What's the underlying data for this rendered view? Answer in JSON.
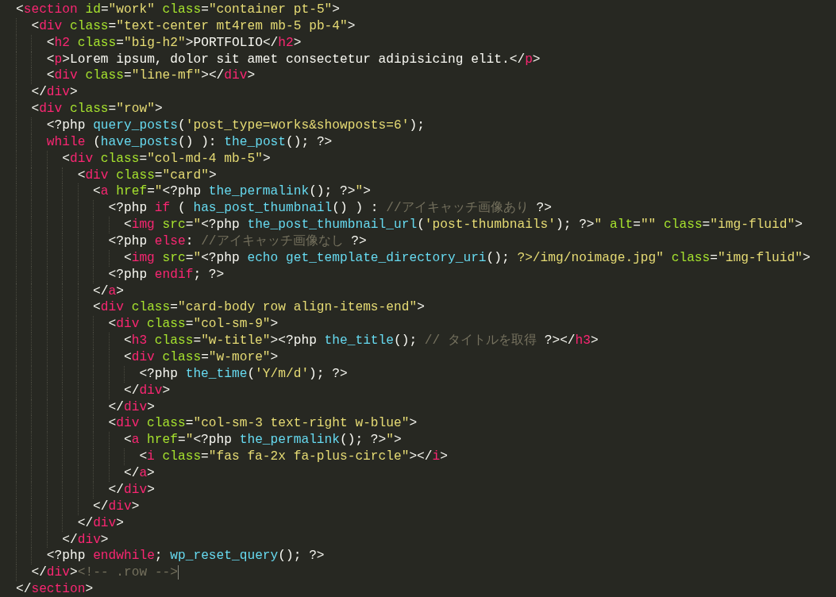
{
  "editor": {
    "lines": [
      {
        "cursor": false,
        "tokens": [
          {
            "kind": "punct",
            "text": "<"
          },
          {
            "kind": "tag",
            "text": "section"
          },
          {
            "kind": "attr",
            "text": " id"
          },
          {
            "kind": "punct",
            "text": "="
          },
          {
            "kind": "string",
            "text": "\"work\""
          },
          {
            "kind": "attr",
            "text": " class"
          },
          {
            "kind": "punct",
            "text": "="
          },
          {
            "kind": "string",
            "text": "\"container pt-5\""
          },
          {
            "kind": "punct",
            "text": ">"
          }
        ]
      },
      {
        "cursor": false,
        "tokens": [
          {
            "kind": "punct",
            "text": "  <"
          },
          {
            "kind": "tag",
            "text": "div"
          },
          {
            "kind": "attr",
            "text": " class"
          },
          {
            "kind": "punct",
            "text": "="
          },
          {
            "kind": "string",
            "text": "\"text-center mt4rem mb-5 pb-4\""
          },
          {
            "kind": "punct",
            "text": ">"
          }
        ]
      },
      {
        "cursor": false,
        "tokens": [
          {
            "kind": "punct",
            "text": "    <"
          },
          {
            "kind": "tag",
            "text": "h2"
          },
          {
            "kind": "attr",
            "text": " class"
          },
          {
            "kind": "punct",
            "text": "="
          },
          {
            "kind": "string",
            "text": "\"big-h2\""
          },
          {
            "kind": "punct",
            "text": ">PORTFOLIO</"
          },
          {
            "kind": "tag",
            "text": "h2"
          },
          {
            "kind": "punct",
            "text": ">"
          }
        ]
      },
      {
        "cursor": false,
        "tokens": [
          {
            "kind": "punct",
            "text": "    <"
          },
          {
            "kind": "tag",
            "text": "p"
          },
          {
            "kind": "punct",
            "text": ">Lorem ipsum, dolor sit amet consectetur adipisicing elit.</"
          },
          {
            "kind": "tag",
            "text": "p"
          },
          {
            "kind": "punct",
            "text": ">"
          }
        ]
      },
      {
        "cursor": false,
        "tokens": [
          {
            "kind": "punct",
            "text": "    <"
          },
          {
            "kind": "tag",
            "text": "div"
          },
          {
            "kind": "attr",
            "text": " class"
          },
          {
            "kind": "punct",
            "text": "="
          },
          {
            "kind": "string",
            "text": "\"line-mf\""
          },
          {
            "kind": "punct",
            "text": "></"
          },
          {
            "kind": "tag",
            "text": "div"
          },
          {
            "kind": "punct",
            "text": ">"
          }
        ]
      },
      {
        "cursor": false,
        "tokens": [
          {
            "kind": "punct",
            "text": "  </"
          },
          {
            "kind": "tag",
            "text": "div"
          },
          {
            "kind": "punct",
            "text": ">"
          }
        ]
      },
      {
        "cursor": false,
        "tokens": [
          {
            "kind": "punct",
            "text": "  <"
          },
          {
            "kind": "tag",
            "text": "div"
          },
          {
            "kind": "attr",
            "text": " class"
          },
          {
            "kind": "punct",
            "text": "="
          },
          {
            "kind": "string",
            "text": "\"row\""
          },
          {
            "kind": "punct",
            "text": ">"
          }
        ]
      },
      {
        "cursor": false,
        "tokens": [
          {
            "kind": "punct",
            "text": "    <?php "
          },
          {
            "kind": "func",
            "text": "query_posts"
          },
          {
            "kind": "punct",
            "text": "("
          },
          {
            "kind": "string",
            "text": "'post_type=works&showposts=6'"
          },
          {
            "kind": "punct",
            "text": ");"
          }
        ]
      },
      {
        "cursor": false,
        "tokens": [
          {
            "kind": "keyword",
            "text": "    while"
          },
          {
            "kind": "punct",
            "text": " ("
          },
          {
            "kind": "func",
            "text": "have_posts"
          },
          {
            "kind": "punct",
            "text": "() ): "
          },
          {
            "kind": "func",
            "text": "the_post"
          },
          {
            "kind": "punct",
            "text": "(); ?>"
          }
        ]
      },
      {
        "cursor": false,
        "tokens": [
          {
            "kind": "punct",
            "text": "      <"
          },
          {
            "kind": "tag",
            "text": "div"
          },
          {
            "kind": "attr",
            "text": " class"
          },
          {
            "kind": "punct",
            "text": "="
          },
          {
            "kind": "string",
            "text": "\"col-md-4 mb-5\""
          },
          {
            "kind": "punct",
            "text": ">"
          }
        ]
      },
      {
        "cursor": false,
        "tokens": [
          {
            "kind": "punct",
            "text": "        <"
          },
          {
            "kind": "tag",
            "text": "div"
          },
          {
            "kind": "attr",
            "text": " class"
          },
          {
            "kind": "punct",
            "text": "="
          },
          {
            "kind": "string",
            "text": "\"card\""
          },
          {
            "kind": "punct",
            "text": ">"
          }
        ]
      },
      {
        "cursor": false,
        "tokens": [
          {
            "kind": "punct",
            "text": "          <"
          },
          {
            "kind": "tag",
            "text": "a"
          },
          {
            "kind": "attr",
            "text": " href"
          },
          {
            "kind": "punct",
            "text": "="
          },
          {
            "kind": "string",
            "text": "\""
          },
          {
            "kind": "punct",
            "text": "<?php "
          },
          {
            "kind": "func",
            "text": "the_permalink"
          },
          {
            "kind": "punct",
            "text": "(); ?>"
          },
          {
            "kind": "string",
            "text": "\""
          },
          {
            "kind": "punct",
            "text": ">"
          }
        ]
      },
      {
        "cursor": false,
        "tokens": [
          {
            "kind": "punct",
            "text": "            <?php "
          },
          {
            "kind": "keyword",
            "text": "if"
          },
          {
            "kind": "punct",
            "text": " ( "
          },
          {
            "kind": "func",
            "text": "has_post_thumbnail"
          },
          {
            "kind": "punct",
            "text": "() ) : "
          },
          {
            "kind": "comment",
            "text": "//アイキャッチ画像あり"
          },
          {
            "kind": "punct",
            "text": " ?>"
          }
        ]
      },
      {
        "cursor": false,
        "tokens": [
          {
            "kind": "punct",
            "text": "              <"
          },
          {
            "kind": "tag",
            "text": "img"
          },
          {
            "kind": "attr",
            "text": " src"
          },
          {
            "kind": "punct",
            "text": "="
          },
          {
            "kind": "string",
            "text": "\""
          },
          {
            "kind": "punct",
            "text": "<?php "
          },
          {
            "kind": "func",
            "text": "the_post_thumbnail_url"
          },
          {
            "kind": "punct",
            "text": "("
          },
          {
            "kind": "string",
            "text": "'post-thumbnails'"
          },
          {
            "kind": "punct",
            "text": "); ?>"
          },
          {
            "kind": "string",
            "text": "\""
          },
          {
            "kind": "attr",
            "text": " alt"
          },
          {
            "kind": "punct",
            "text": "="
          },
          {
            "kind": "string",
            "text": "\"\""
          },
          {
            "kind": "attr",
            "text": " class"
          },
          {
            "kind": "punct",
            "text": "="
          },
          {
            "kind": "string",
            "text": "\"img-fluid\""
          },
          {
            "kind": "punct",
            "text": ">"
          }
        ]
      },
      {
        "cursor": false,
        "tokens": [
          {
            "kind": "punct",
            "text": "            <?php "
          },
          {
            "kind": "keyword",
            "text": "else"
          },
          {
            "kind": "punct",
            "text": ": "
          },
          {
            "kind": "comment",
            "text": "//アイキャッチ画像なし"
          },
          {
            "kind": "punct",
            "text": " ?>"
          }
        ]
      },
      {
        "cursor": false,
        "tokens": [
          {
            "kind": "punct",
            "text": "              <"
          },
          {
            "kind": "tag",
            "text": "img"
          },
          {
            "kind": "attr",
            "text": " src"
          },
          {
            "kind": "punct",
            "text": "="
          },
          {
            "kind": "string",
            "text": "\""
          },
          {
            "kind": "punct",
            "text": "<?php "
          },
          {
            "kind": "func",
            "text": "echo get_template_directory_uri"
          },
          {
            "kind": "punct",
            "text": "(); "
          },
          {
            "kind": "string",
            "text": "?>/img/noimage.jpg\""
          },
          {
            "kind": "attr",
            "text": " class"
          },
          {
            "kind": "punct",
            "text": "="
          },
          {
            "kind": "string",
            "text": "\"img-fluid\""
          },
          {
            "kind": "punct",
            "text": ">"
          }
        ]
      },
      {
        "cursor": false,
        "tokens": [
          {
            "kind": "punct",
            "text": "            <?php "
          },
          {
            "kind": "keyword",
            "text": "endif"
          },
          {
            "kind": "punct",
            "text": "; ?>"
          }
        ]
      },
      {
        "cursor": false,
        "tokens": [
          {
            "kind": "punct",
            "text": "          </"
          },
          {
            "kind": "tag",
            "text": "a"
          },
          {
            "kind": "punct",
            "text": ">"
          }
        ]
      },
      {
        "cursor": false,
        "tokens": [
          {
            "kind": "punct",
            "text": "          <"
          },
          {
            "kind": "tag",
            "text": "div"
          },
          {
            "kind": "attr",
            "text": " class"
          },
          {
            "kind": "punct",
            "text": "="
          },
          {
            "kind": "string",
            "text": "\"card-body row align-items-end\""
          },
          {
            "kind": "punct",
            "text": ">"
          }
        ]
      },
      {
        "cursor": false,
        "tokens": [
          {
            "kind": "punct",
            "text": "            <"
          },
          {
            "kind": "tag",
            "text": "div"
          },
          {
            "kind": "attr",
            "text": " class"
          },
          {
            "kind": "punct",
            "text": "="
          },
          {
            "kind": "string",
            "text": "\"col-sm-9\""
          },
          {
            "kind": "punct",
            "text": ">"
          }
        ]
      },
      {
        "cursor": false,
        "tokens": [
          {
            "kind": "punct",
            "text": "              <"
          },
          {
            "kind": "tag",
            "text": "h3"
          },
          {
            "kind": "attr",
            "text": " class"
          },
          {
            "kind": "punct",
            "text": "="
          },
          {
            "kind": "string",
            "text": "\"w-title\""
          },
          {
            "kind": "punct",
            "text": "><?php "
          },
          {
            "kind": "func",
            "text": "the_title"
          },
          {
            "kind": "punct",
            "text": "(); "
          },
          {
            "kind": "comment",
            "text": "// タイトルを取得"
          },
          {
            "kind": "punct",
            "text": " ?></"
          },
          {
            "kind": "tag",
            "text": "h3"
          },
          {
            "kind": "punct",
            "text": ">"
          }
        ]
      },
      {
        "cursor": false,
        "tokens": [
          {
            "kind": "punct",
            "text": "              <"
          },
          {
            "kind": "tag",
            "text": "div"
          },
          {
            "kind": "attr",
            "text": " class"
          },
          {
            "kind": "punct",
            "text": "="
          },
          {
            "kind": "string",
            "text": "\"w-more\""
          },
          {
            "kind": "punct",
            "text": ">"
          }
        ]
      },
      {
        "cursor": false,
        "tokens": [
          {
            "kind": "punct",
            "text": "                <?php "
          },
          {
            "kind": "func",
            "text": "the_time"
          },
          {
            "kind": "punct",
            "text": "("
          },
          {
            "kind": "string",
            "text": "'Y/m/d'"
          },
          {
            "kind": "punct",
            "text": "); ?>"
          }
        ]
      },
      {
        "cursor": false,
        "tokens": [
          {
            "kind": "punct",
            "text": "              </"
          },
          {
            "kind": "tag",
            "text": "div"
          },
          {
            "kind": "punct",
            "text": ">"
          }
        ]
      },
      {
        "cursor": false,
        "tokens": [
          {
            "kind": "punct",
            "text": "            </"
          },
          {
            "kind": "tag",
            "text": "div"
          },
          {
            "kind": "punct",
            "text": ">"
          }
        ]
      },
      {
        "cursor": false,
        "tokens": [
          {
            "kind": "punct",
            "text": "            <"
          },
          {
            "kind": "tag",
            "text": "div"
          },
          {
            "kind": "attr",
            "text": " class"
          },
          {
            "kind": "punct",
            "text": "="
          },
          {
            "kind": "string",
            "text": "\"col-sm-3 text-right w-blue\""
          },
          {
            "kind": "punct",
            "text": ">"
          }
        ]
      },
      {
        "cursor": false,
        "tokens": [
          {
            "kind": "punct",
            "text": "              <"
          },
          {
            "kind": "tag",
            "text": "a"
          },
          {
            "kind": "attr",
            "text": " href"
          },
          {
            "kind": "punct",
            "text": "="
          },
          {
            "kind": "string",
            "text": "\""
          },
          {
            "kind": "punct",
            "text": "<?php "
          },
          {
            "kind": "func",
            "text": "the_permalink"
          },
          {
            "kind": "punct",
            "text": "(); ?>"
          },
          {
            "kind": "string",
            "text": "\""
          },
          {
            "kind": "punct",
            "text": ">"
          }
        ]
      },
      {
        "cursor": false,
        "tokens": [
          {
            "kind": "punct",
            "text": "                <"
          },
          {
            "kind": "tag",
            "text": "i"
          },
          {
            "kind": "attr",
            "text": " class"
          },
          {
            "kind": "punct",
            "text": "="
          },
          {
            "kind": "string",
            "text": "\"fas fa-2x fa-plus-circle\""
          },
          {
            "kind": "punct",
            "text": "></"
          },
          {
            "kind": "tag",
            "text": "i"
          },
          {
            "kind": "punct",
            "text": ">"
          }
        ]
      },
      {
        "cursor": false,
        "tokens": [
          {
            "kind": "punct",
            "text": "              </"
          },
          {
            "kind": "tag",
            "text": "a"
          },
          {
            "kind": "punct",
            "text": ">"
          }
        ]
      },
      {
        "cursor": false,
        "tokens": [
          {
            "kind": "punct",
            "text": "            </"
          },
          {
            "kind": "tag",
            "text": "div"
          },
          {
            "kind": "punct",
            "text": ">"
          }
        ]
      },
      {
        "cursor": false,
        "tokens": [
          {
            "kind": "punct",
            "text": "          </"
          },
          {
            "kind": "tag",
            "text": "div"
          },
          {
            "kind": "punct",
            "text": ">"
          }
        ]
      },
      {
        "cursor": false,
        "tokens": [
          {
            "kind": "punct",
            "text": "        </"
          },
          {
            "kind": "tag",
            "text": "div"
          },
          {
            "kind": "punct",
            "text": ">"
          }
        ]
      },
      {
        "cursor": false,
        "tokens": [
          {
            "kind": "punct",
            "text": "      </"
          },
          {
            "kind": "tag",
            "text": "div"
          },
          {
            "kind": "punct",
            "text": ">"
          }
        ]
      },
      {
        "cursor": false,
        "tokens": [
          {
            "kind": "punct",
            "text": "    <?php "
          },
          {
            "kind": "keyword",
            "text": "endwhile"
          },
          {
            "kind": "punct",
            "text": "; "
          },
          {
            "kind": "func",
            "text": "wp_reset_query"
          },
          {
            "kind": "punct",
            "text": "(); ?>"
          }
        ]
      },
      {
        "cursor": true,
        "tokens": [
          {
            "kind": "punct",
            "text": "  </"
          },
          {
            "kind": "tag",
            "text": "div"
          },
          {
            "kind": "punct",
            "text": ">"
          },
          {
            "kind": "comment",
            "text": "<!-- .row -->"
          }
        ]
      },
      {
        "cursor": false,
        "tokens": [
          {
            "kind": "punct",
            "text": "</"
          },
          {
            "kind": "tag",
            "text": "section"
          },
          {
            "kind": "punct",
            "text": ">"
          }
        ]
      }
    ]
  }
}
